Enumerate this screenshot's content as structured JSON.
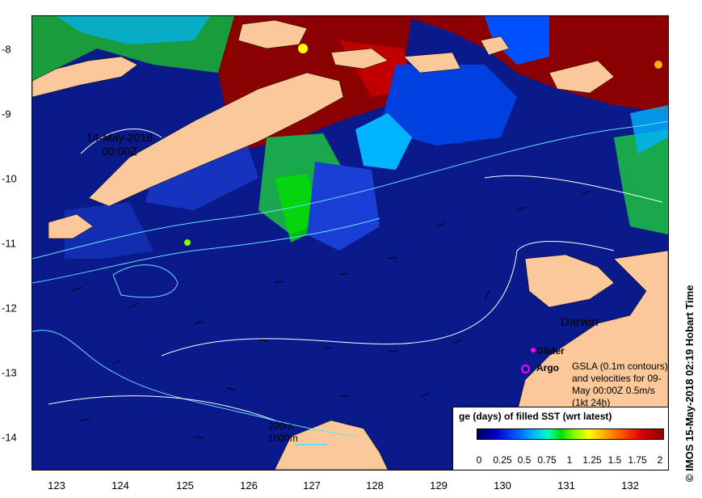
{
  "map": {
    "x_ticks": [
      "123",
      "124",
      "125",
      "126",
      "127",
      "128",
      "129",
      "130",
      "131",
      "132"
    ],
    "y_ticks": [
      "-8",
      "-9",
      "-10",
      "-11",
      "-12",
      "-13",
      "-14"
    ],
    "timestamp_line1": "14-May-2018",
    "timestamp_line2": "00:00Z",
    "city": "Darwin",
    "legend": {
      "glider": "Glider",
      "argo": "Argo",
      "gsla_note": "GSLA (0.1m contours) and velocities for 09-May 00:00Z 0.5m/s (1kt 24h)",
      "depth_200": "200m",
      "depth_1000": "1000m"
    },
    "colorbar": {
      "title": "ge (days) of filled SST (wrt latest)",
      "ticks": [
        "0",
        "0.25",
        "0.5",
        "0.75",
        "1",
        "1.25",
        "1.5",
        "1.75",
        "2"
      ],
      "colors": [
        "#000064",
        "#0000c8",
        "#0050ff",
        "#00b4ff",
        "#00ffc0",
        "#00e000",
        "#80ff00",
        "#ffff00",
        "#ffb000",
        "#ff5000",
        "#e00000",
        "#8b0000"
      ]
    },
    "credit": "© IMOS 15-May-2018 02:19 Hobart Time",
    "colors": {
      "land": "#fbc89a",
      "ocean": "#0a1a8a",
      "contour": "#ffffff",
      "bathymetry": "#66e0ff",
      "recent": "#8b0000"
    }
  }
}
